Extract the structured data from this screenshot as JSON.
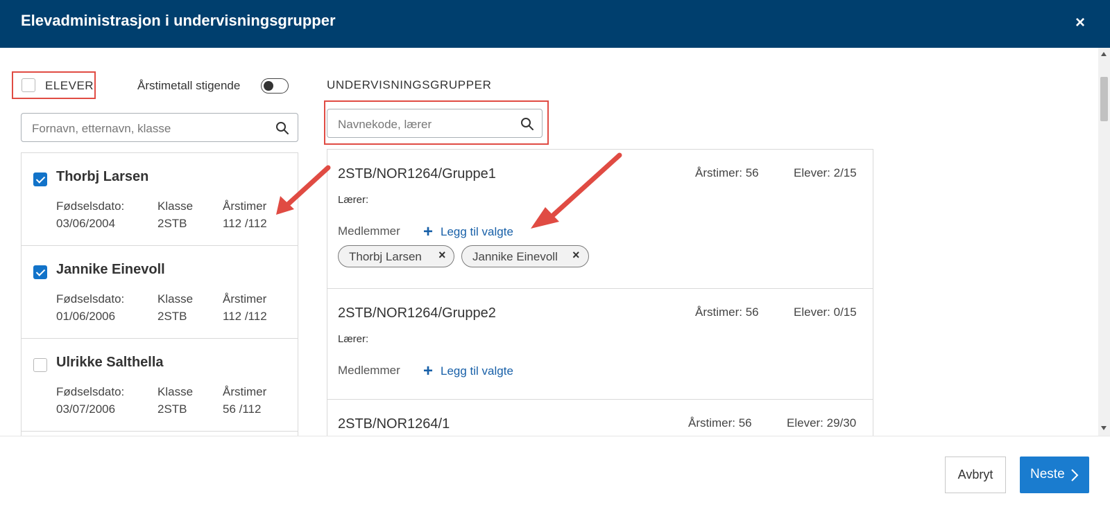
{
  "header": {
    "title": "Elevadministrasjon i undervisningsgrupper",
    "close_label": "×"
  },
  "left": {
    "elever_label": "ELEVER",
    "elever_checked": false,
    "sort_label": "Årstimetall stigende",
    "sort_toggle_on": false,
    "search_placeholder": "Fornavn, etternavn, klasse",
    "field_labels": {
      "birth": "Fødselsdato:",
      "class": "Klasse",
      "hours": "Årstimer"
    },
    "students": [
      {
        "name": "Thorbj Larsen",
        "checked": true,
        "birth": "03/06/2004",
        "class": "2STB",
        "hours": "112 /112"
      },
      {
        "name": "Jannike Einevoll",
        "checked": true,
        "birth": "01/06/2006",
        "class": "2STB",
        "hours": "112 /112"
      },
      {
        "name": "Ulrikke Salthella",
        "checked": false,
        "birth": "03/07/2006",
        "class": "2STB",
        "hours": "56 /112"
      }
    ]
  },
  "right": {
    "heading": "UNDERVISNINGSGRUPPER",
    "search_placeholder": "Navnekode, lærer",
    "teacher_label": "Lærer:",
    "members_label": "Medlemmer",
    "add_label": "Legg til valgte",
    "groups": [
      {
        "name": "2STB/NOR1264/Gruppe1",
        "hours": "Årstimer: 56",
        "students": "Elever: 2/15",
        "members": [
          "Thorbj Larsen",
          "Jannike Einevoll"
        ]
      },
      {
        "name": "2STB/NOR1264/Gruppe2",
        "hours": "Årstimer: 56",
        "students": "Elever: 0/15",
        "members": []
      },
      {
        "name": "2STB/NOR1264/1",
        "hours": "Årstimer: 56",
        "students": "Elever: 29/30",
        "members": []
      }
    ]
  },
  "footer": {
    "cancel_label": "Avbryt",
    "next_label": "Neste"
  },
  "colors": {
    "header_bg": "#003f6e",
    "accent": "#1a7ccf",
    "highlight_red": "#e04b43",
    "link": "#1860a8"
  }
}
